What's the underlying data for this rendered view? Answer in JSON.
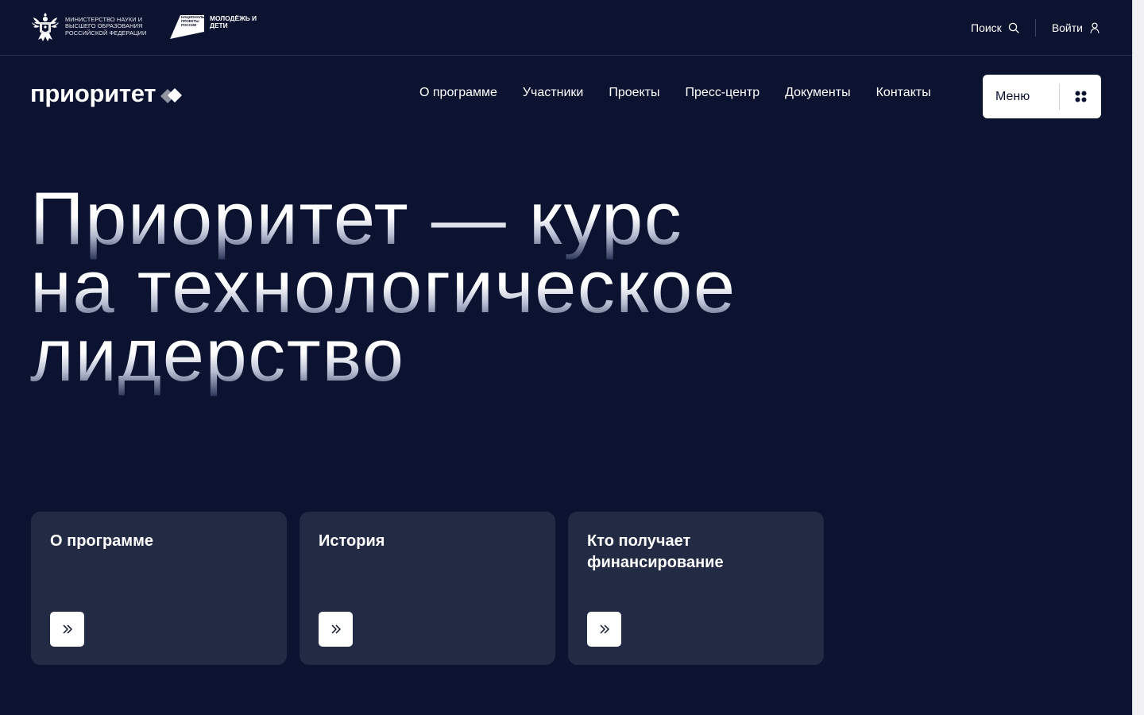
{
  "header": {
    "ministry_text": "Министерство науки и высшего образования Российской Федерации",
    "np_logo_small": "Национальные проекты России",
    "np_title": "Молодёжь и дети",
    "search_label": "Поиск",
    "login_label": "Войти"
  },
  "brand": {
    "name": "приоритет"
  },
  "nav": {
    "items": [
      "О программе",
      "Участники",
      "Проекты",
      "Пресс-центр",
      "Документы",
      "Контакты"
    ],
    "menu_label": "Меню"
  },
  "hero": {
    "lines": [
      "Приоритет — курс",
      "на технологическое",
      "лидерство"
    ]
  },
  "cards": [
    {
      "title": "О программе"
    },
    {
      "title": "История"
    },
    {
      "title": "Кто получает финансирование"
    }
  ],
  "colors": {
    "background": "#0b1330",
    "card": "#222a44",
    "text": "#ffffff"
  },
  "icons": {
    "search": "search-icon",
    "login": "user-icon",
    "menu": "grid-dots-icon",
    "card_arrow": "double-chevron-right-icon"
  }
}
